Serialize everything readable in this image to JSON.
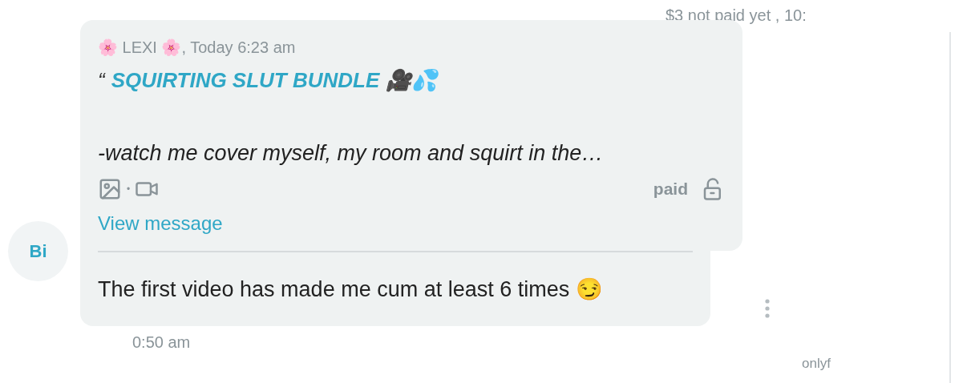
{
  "top_status": "$3 not paid yet , 10:",
  "message": {
    "sender_line": "🌸 LEXI 🌸, Today 6:23 am",
    "quote_mark": "“",
    "title": "SQUIRTING SLUT BUNDLE 🎥💦",
    "preview": "-watch me cover myself, my room and squirt in the…",
    "attachment_separator": "•",
    "price_status": "paid",
    "link": "View message"
  },
  "reply": {
    "avatar": "Bi",
    "text": "The first video has made me cum at least 6 times 😏",
    "time": "0:50 am"
  },
  "footer_text": "onlyf"
}
